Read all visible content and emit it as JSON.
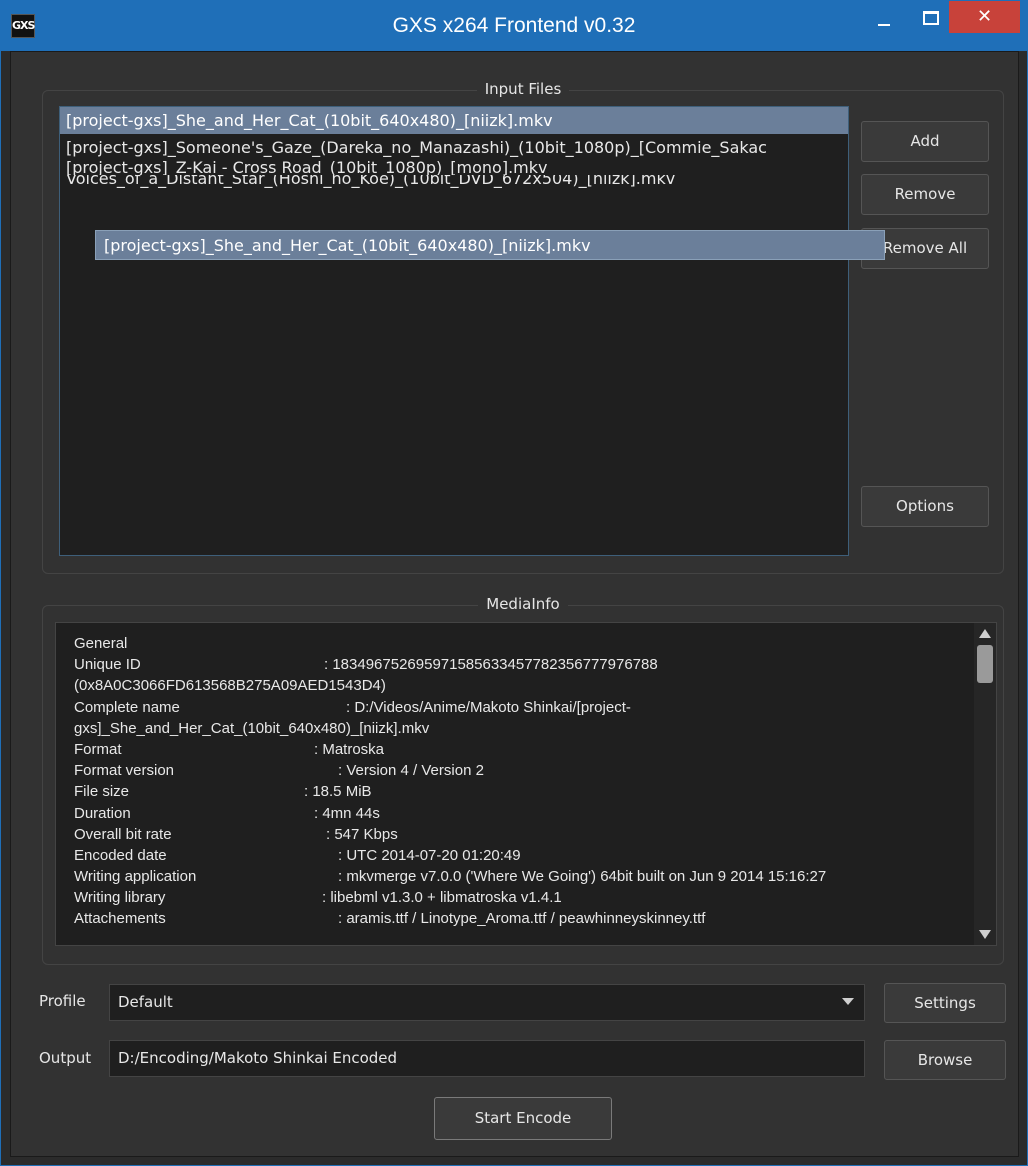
{
  "window": {
    "title": "GXS x264 Frontend v0.32",
    "app_icon_text": "GXS",
    "close_glyph": "✕"
  },
  "input_files": {
    "group_title": "Input Files",
    "files": [
      "[project-gxs]_She_and_Her_Cat_(10bit_640x480)_[niizk].mkv",
      "[project-gxs]_Someone's_Gaze_(Dareka_no_Manazashi)_(10bit_1080p)_[Commie_Sakac",
      "[project-gxs]_Z-Kai - Cross Road_(10bit_1080p)_[mono].mkv",
      "Voices_of_a_Distant_Star_(Hoshi_no_Koe)_(10bit_DVD_672x504)_[niizk].mkv"
    ],
    "selected_index": 0,
    "drag_ghost_label": "[project-gxs]_She_and_Her_Cat_(10bit_640x480)_[niizk].mkv",
    "buttons": {
      "add": "Add",
      "remove": "Remove",
      "remove_all": "Remove All",
      "options": "Options"
    }
  },
  "media_info": {
    "group_title": "MediaInfo",
    "lines": [
      {
        "k": "General",
        "v": ""
      },
      {
        "k": "Unique ID",
        "v": ": 183496752695971585633457782356777976788"
      },
      {
        "k": "(0x8A0C3066FD613568B275A09AED1543D4)",
        "v": ""
      },
      {
        "k": "Complete name",
        "v": ": D:/Videos/Anime/Makoto Shinkai/[project-"
      },
      {
        "k": "gxs]_She_and_Her_Cat_(10bit_640x480)_[niizk].mkv",
        "v": ""
      },
      {
        "k": "Format",
        "v": ": Matroska"
      },
      {
        "k": "Format version",
        "v": ": Version 4 / Version 2"
      },
      {
        "k": "File size",
        "v": ": 18.5 MiB"
      },
      {
        "k": "Duration",
        "v": ": 4mn 44s"
      },
      {
        "k": "Overall bit rate",
        "v": ": 547 Kbps"
      },
      {
        "k": "Encoded date",
        "v": ": UTC 2014-07-20 01:20:49"
      },
      {
        "k": "Writing application",
        "v": ": mkvmerge v7.0.0 ('Where We Going') 64bit built on Jun  9 2014 15:16:27"
      },
      {
        "k": "Writing library",
        "v": ": libebml v1.3.0 + libmatroska v1.4.1"
      },
      {
        "k": "Attachements",
        "v": ": aramis.ttf / Linotype_Aroma.ttf / peawhinneyskinney.ttf"
      }
    ]
  },
  "profile": {
    "label": "Profile",
    "value": "Default",
    "settings_button": "Settings"
  },
  "output": {
    "label": "Output",
    "value": "D:/Encoding/Makoto Shinkai Encoded",
    "browse_button": "Browse"
  },
  "start_button": "Start Encode"
}
